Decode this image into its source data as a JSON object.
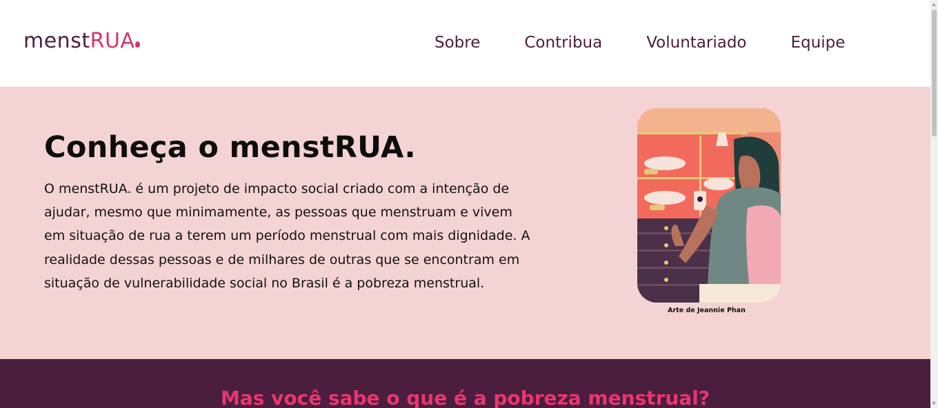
{
  "header": {
    "logo_part1": "menst",
    "logo_part2": "RUA",
    "nav": [
      "Sobre",
      "Contribua",
      "Voluntariado",
      "Equipe"
    ]
  },
  "hero": {
    "title": "Conheça o menstRUA.",
    "description": "O menstRUA. é um projeto de impacto social criado com a intenção de ajudar, mesmo que minimamente, as pessoas que menstruam e vivem em situação de rua a terem um período menstrual com mais dignidade. A realidade dessas pessoas e de milhares de outras que se encontram em situação de vulnerabilidade social no Brasil é a pobreza menstrual.",
    "caption": "Arte de Jeannie Phan"
  },
  "section2": {
    "heading": "Mas você sabe o que é a pobreza menstrual?"
  },
  "colors": {
    "brand_dark": "#4b1e3e",
    "brand_pink": "#d6336c",
    "hero_bg": "#f4d3d4",
    "heading_pink": "#e8366f"
  }
}
